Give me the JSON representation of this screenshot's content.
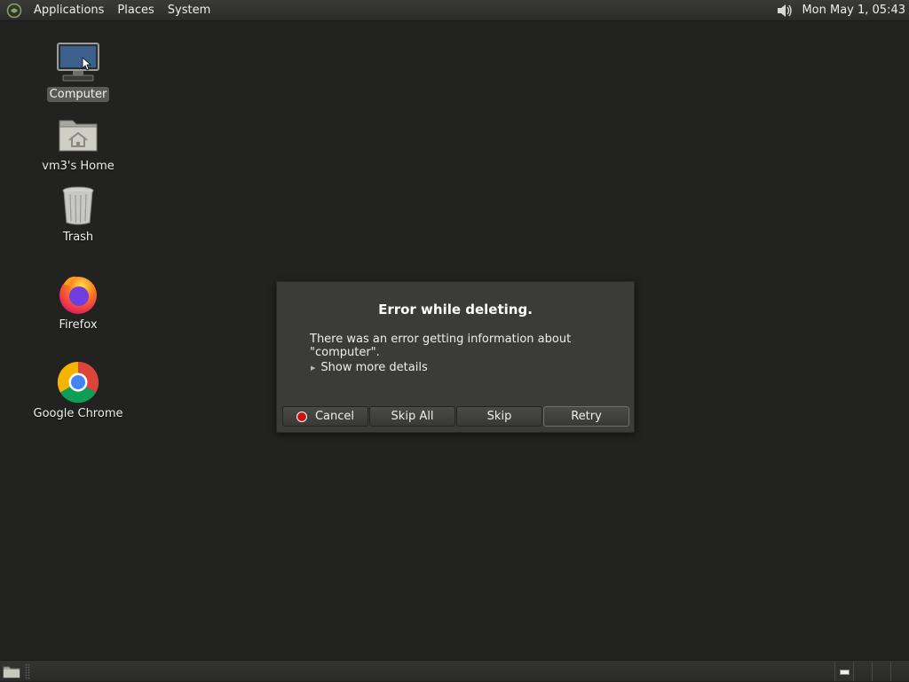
{
  "top_panel": {
    "menus": [
      "Applications",
      "Places",
      "System"
    ],
    "clock": "Mon May  1, 05:43"
  },
  "desktop_icons": [
    {
      "label": "Computer",
      "icon": "computer-icon",
      "selected": true
    },
    {
      "label": "vm3's Home",
      "icon": "home-folder-icon"
    },
    {
      "label": "Trash",
      "icon": "trash-icon"
    },
    {
      "label": "Firefox",
      "icon": "firefox-icon"
    },
    {
      "label": "Google Chrome",
      "icon": "chrome-icon"
    }
  ],
  "dialog": {
    "title": "Error while deleting.",
    "message": "There was an error getting information about \"computer\".",
    "details_label": "Show more details",
    "buttons": {
      "cancel": "Cancel",
      "skip_all": "Skip All",
      "skip": "Skip",
      "retry": "Retry"
    }
  },
  "colors": {
    "desktop_bg": "#222321",
    "dialog_bg": "#3b3b3a",
    "cancel_icon": "#cc1111"
  }
}
